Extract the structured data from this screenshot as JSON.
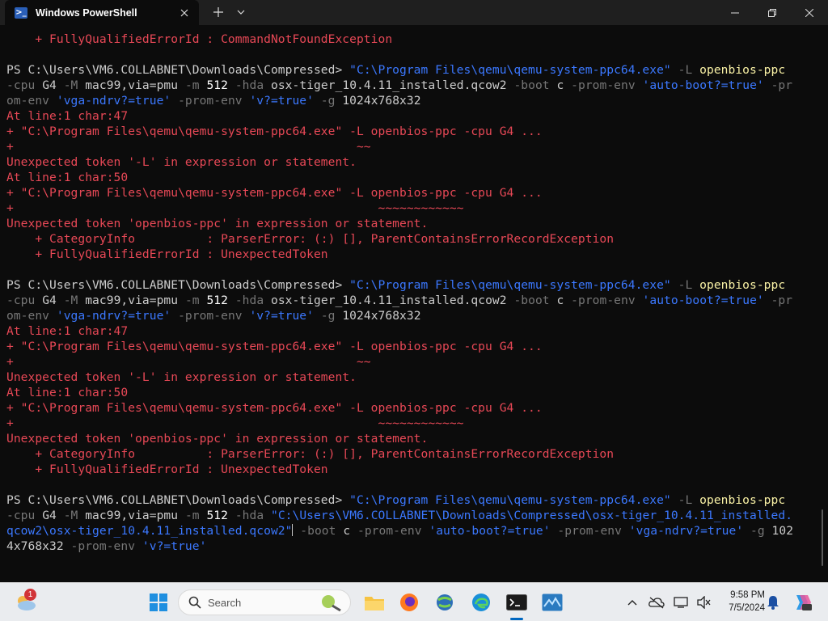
{
  "window": {
    "tab_title": "Windows PowerShell",
    "tab_icon": "powershell-icon"
  },
  "terminal": {
    "lines": [
      {
        "segs": [
          {
            "c": "err",
            "t": "    + FullyQualifiedErrorId : CommandNotFoundException"
          }
        ]
      },
      {
        "segs": []
      },
      {
        "segs": [
          {
            "c": "",
            "t": "PS C:\\Users\\VM6.COLLABNET\\Downloads\\Compressed> "
          },
          {
            "c": "str",
            "t": "\"C:\\Program Files\\qemu\\qemu-system-ppc64.exe\""
          },
          {
            "c": "prm",
            "t": " -L "
          },
          {
            "c": "cmd",
            "t": "openbios-ppc"
          }
        ]
      },
      {
        "segs": [
          {
            "c": "prm",
            "t": "-cpu "
          },
          {
            "c": "",
            "t": "G4 "
          },
          {
            "c": "prm",
            "t": "-M "
          },
          {
            "c": "",
            "t": "mac99,via=pmu "
          },
          {
            "c": "prm",
            "t": "-m "
          },
          {
            "c": "num",
            "t": "512 "
          },
          {
            "c": "prm",
            "t": "-hda "
          },
          {
            "c": "",
            "t": "osx-tiger_10.4.11_installed.qcow2 "
          },
          {
            "c": "prm",
            "t": "-boot "
          },
          {
            "c": "",
            "t": "c "
          },
          {
            "c": "prm",
            "t": "-prom-env "
          },
          {
            "c": "str",
            "t": "'auto-boot?=true'"
          },
          {
            "c": "prm",
            "t": " -pr"
          }
        ]
      },
      {
        "segs": [
          {
            "c": "prm",
            "t": "om-env "
          },
          {
            "c": "str",
            "t": "'vga-ndrv?=true'"
          },
          {
            "c": "prm",
            "t": " -prom-env "
          },
          {
            "c": "str",
            "t": "'v?=true'"
          },
          {
            "c": "prm",
            "t": " -g "
          },
          {
            "c": "",
            "t": "1024x768x32"
          }
        ]
      },
      {
        "segs": [
          {
            "c": "err",
            "t": "At line:1 char:47"
          }
        ]
      },
      {
        "segs": [
          {
            "c": "err",
            "t": "+ \"C:\\Program Files\\qemu\\qemu-system-ppc64.exe\" -L openbios-ppc -cpu G4 ..."
          }
        ]
      },
      {
        "segs": [
          {
            "c": "err",
            "t": "+                                                ~~"
          }
        ]
      },
      {
        "segs": [
          {
            "c": "err",
            "t": "Unexpected token '-L' in expression or statement."
          }
        ]
      },
      {
        "segs": [
          {
            "c": "err",
            "t": "At line:1 char:50"
          }
        ]
      },
      {
        "segs": [
          {
            "c": "err",
            "t": "+ \"C:\\Program Files\\qemu\\qemu-system-ppc64.exe\" -L openbios-ppc -cpu G4 ..."
          }
        ]
      },
      {
        "segs": [
          {
            "c": "err",
            "t": "+                                                   ~~~~~~~~~~~~"
          }
        ]
      },
      {
        "segs": [
          {
            "c": "err",
            "t": "Unexpected token 'openbios-ppc' in expression or statement."
          }
        ]
      },
      {
        "segs": [
          {
            "c": "err",
            "t": "    + CategoryInfo          : ParserError: (:) [], ParentContainsErrorRecordException"
          }
        ]
      },
      {
        "segs": [
          {
            "c": "err",
            "t": "    + FullyQualifiedErrorId : UnexpectedToken"
          }
        ]
      },
      {
        "segs": []
      },
      {
        "segs": [
          {
            "c": "",
            "t": "PS C:\\Users\\VM6.COLLABNET\\Downloads\\Compressed> "
          },
          {
            "c": "str",
            "t": "\"C:\\Program Files\\qemu\\qemu-system-ppc64.exe\""
          },
          {
            "c": "prm",
            "t": " -L "
          },
          {
            "c": "cmd",
            "t": "openbios-ppc"
          }
        ]
      },
      {
        "segs": [
          {
            "c": "prm",
            "t": "-cpu "
          },
          {
            "c": "",
            "t": "G4 "
          },
          {
            "c": "prm",
            "t": "-M "
          },
          {
            "c": "",
            "t": "mac99,via=pmu "
          },
          {
            "c": "prm",
            "t": "-m "
          },
          {
            "c": "num",
            "t": "512 "
          },
          {
            "c": "prm",
            "t": "-hda "
          },
          {
            "c": "",
            "t": "osx-tiger_10.4.11_installed.qcow2 "
          },
          {
            "c": "prm",
            "t": "-boot "
          },
          {
            "c": "",
            "t": "c "
          },
          {
            "c": "prm",
            "t": "-prom-env "
          },
          {
            "c": "str",
            "t": "'auto-boot?=true'"
          },
          {
            "c": "prm",
            "t": " -pr"
          }
        ]
      },
      {
        "segs": [
          {
            "c": "prm",
            "t": "om-env "
          },
          {
            "c": "str",
            "t": "'vga-ndrv?=true'"
          },
          {
            "c": "prm",
            "t": " -prom-env "
          },
          {
            "c": "str",
            "t": "'v?=true'"
          },
          {
            "c": "prm",
            "t": " -g "
          },
          {
            "c": "",
            "t": "1024x768x32"
          }
        ]
      },
      {
        "segs": [
          {
            "c": "err",
            "t": "At line:1 char:47"
          }
        ]
      },
      {
        "segs": [
          {
            "c": "err",
            "t": "+ \"C:\\Program Files\\qemu\\qemu-system-ppc64.exe\" -L openbios-ppc -cpu G4 ..."
          }
        ]
      },
      {
        "segs": [
          {
            "c": "err",
            "t": "+                                                ~~"
          }
        ]
      },
      {
        "segs": [
          {
            "c": "err",
            "t": "Unexpected token '-L' in expression or statement."
          }
        ]
      },
      {
        "segs": [
          {
            "c": "err",
            "t": "At line:1 char:50"
          }
        ]
      },
      {
        "segs": [
          {
            "c": "err",
            "t": "+ \"C:\\Program Files\\qemu\\qemu-system-ppc64.exe\" -L openbios-ppc -cpu G4 ..."
          }
        ]
      },
      {
        "segs": [
          {
            "c": "err",
            "t": "+                                                   ~~~~~~~~~~~~"
          }
        ]
      },
      {
        "segs": [
          {
            "c": "err",
            "t": "Unexpected token 'openbios-ppc' in expression or statement."
          }
        ]
      },
      {
        "segs": [
          {
            "c": "err",
            "t": "    + CategoryInfo          : ParserError: (:) [], ParentContainsErrorRecordException"
          }
        ]
      },
      {
        "segs": [
          {
            "c": "err",
            "t": "    + FullyQualifiedErrorId : UnexpectedToken"
          }
        ]
      },
      {
        "segs": []
      },
      {
        "segs": [
          {
            "c": "",
            "t": "PS C:\\Users\\VM6.COLLABNET\\Downloads\\Compressed> "
          },
          {
            "c": "str",
            "t": "\"C:\\Program Files\\qemu\\qemu-system-ppc64.exe\""
          },
          {
            "c": "prm",
            "t": " -L "
          },
          {
            "c": "cmd",
            "t": "openbios-ppc"
          }
        ]
      },
      {
        "segs": [
          {
            "c": "prm",
            "t": "-cpu "
          },
          {
            "c": "",
            "t": "G4 "
          },
          {
            "c": "prm",
            "t": "-M "
          },
          {
            "c": "",
            "t": "mac99,via=pmu "
          },
          {
            "c": "prm",
            "t": "-m "
          },
          {
            "c": "num",
            "t": "512 "
          },
          {
            "c": "prm",
            "t": "-hda "
          },
          {
            "c": "str",
            "t": "\"C:\\Users\\VM6.COLLABNET\\Downloads\\Compressed\\osx-tiger_10.4.11_installed."
          }
        ]
      },
      {
        "segs": [
          {
            "c": "str",
            "t": "qcow2\\osx-tiger_10.4.11_installed.qcow2\""
          },
          {
            "c": "cursor",
            "t": ""
          },
          {
            "c": "prm",
            "t": " -boot "
          },
          {
            "c": "",
            "t": "c "
          },
          {
            "c": "prm",
            "t": "-prom-env "
          },
          {
            "c": "str",
            "t": "'auto-boot?=true'"
          },
          {
            "c": "prm",
            "t": " -prom-env "
          },
          {
            "c": "str",
            "t": "'vga-ndrv?=true'"
          },
          {
            "c": "prm",
            "t": " -g "
          },
          {
            "c": "",
            "t": "102"
          }
        ]
      },
      {
        "segs": [
          {
            "c": "",
            "t": "4x768x32 "
          },
          {
            "c": "prm",
            "t": "-prom-env "
          },
          {
            "c": "str",
            "t": "'v?=true'"
          }
        ]
      }
    ]
  },
  "taskbar": {
    "search_label": "Search",
    "weather_badge": "1",
    "clock_time": "9:58 PM",
    "clock_date": "7/5/2024",
    "items": [
      "windows-start-icon",
      "file-explorer-icon",
      "firefox-icon",
      "network-globe-icon",
      "edge-icon",
      "terminal-icon",
      "app-icon"
    ]
  },
  "colors": {
    "terminal_bg": "#0c0c0c",
    "error_red": "#e74856",
    "string_blue": "#3b78ff",
    "command_yellow": "#f9f1a5",
    "param_gray": "#767676",
    "accent": "#0067c0"
  }
}
